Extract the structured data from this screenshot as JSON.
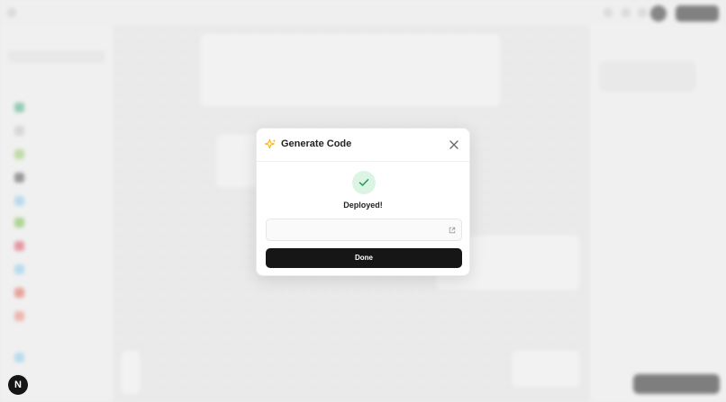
{
  "modal": {
    "title": "Generate Code",
    "status": "Deployed!",
    "url_value": "",
    "done_label": "Done"
  },
  "colors": {
    "sparkle": "#f2b321",
    "success_bg": "#dcf4e4",
    "success_check": "#2e9e5b",
    "primary_button": "#161616"
  },
  "icons": {
    "sparkle": "sparkle-icon",
    "close": "close-icon",
    "check": "check-icon",
    "external_link": "external-link-icon"
  }
}
